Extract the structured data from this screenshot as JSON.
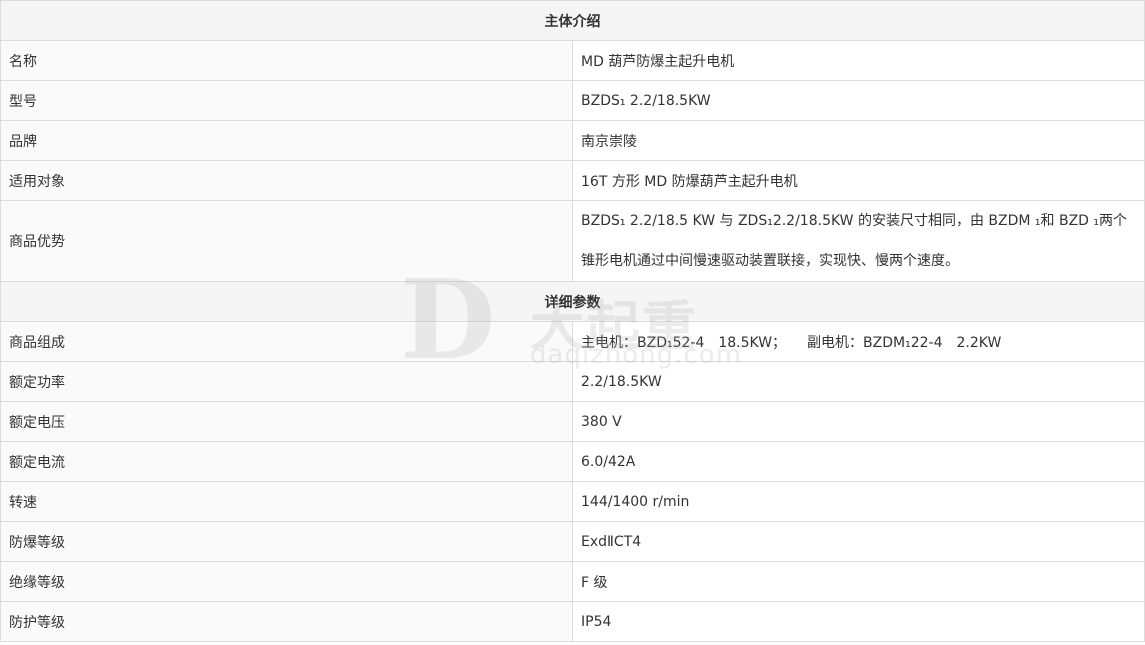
{
  "sections": {
    "intro": "主体介绍",
    "details": "详细参数"
  },
  "intro_rows": [
    {
      "label": "名称",
      "value": "MD 葫芦防爆主起升电机"
    },
    {
      "label": "型号",
      "value": "BZDS₁ 2.2/18.5KW"
    },
    {
      "label": "品牌",
      "value": "南京崇陵"
    },
    {
      "label": "适用对象",
      "value": "16T 方形 MD 防爆葫芦主起升电机"
    },
    {
      "label": "商品优势",
      "value": "BZDS₁ 2.2/18.5 KW 与 ZDS₁2.2/18.5KW 的安装尺寸相同，由 BZDM ₁和 BZD ₁两个锥形电机通过中间慢速驱动装置联接，实现快、慢两个速度。"
    }
  ],
  "detail_rows": [
    {
      "label": "商品组成",
      "value": "主电机：BZD₁52-4　18.5KW；　　副电机：BZDM₁22-4　2.2KW"
    },
    {
      "label": "额定功率",
      "value": "2.2/18.5KW"
    },
    {
      "label": "额定电压",
      "value": "380 V"
    },
    {
      "label": "额定电流",
      "value": "6.0/42A"
    },
    {
      "label": "转速",
      "value": "144/1400 r/min"
    },
    {
      "label": "防爆等级",
      "value": "ExdⅡCT4"
    },
    {
      "label": "绝缘等级",
      "value": "F 级"
    },
    {
      "label": "防护等级",
      "value": "IP54"
    }
  ],
  "watermark": {
    "letter": "D",
    "cn": "大起重",
    "en": "daqizhong.com"
  }
}
